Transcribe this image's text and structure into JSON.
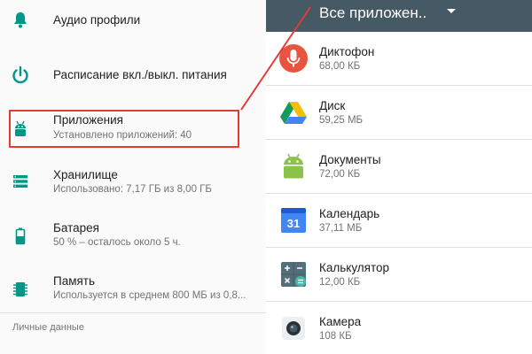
{
  "settings": {
    "items": [
      {
        "title": "Аудио профили",
        "subtitle": "",
        "icon": "bell-icon"
      },
      {
        "title": "Расписание вкл./выкл. питания",
        "subtitle": "",
        "icon": "power-icon"
      },
      {
        "title": "Приложения",
        "subtitle": "Установлено приложений: 40",
        "icon": "android-icon"
      },
      {
        "title": "Хранилище",
        "subtitle": "Использовано: 7,17 ГБ из 8,00 ГБ",
        "icon": "storage-icon"
      },
      {
        "title": "Батарея",
        "subtitle": "50 % – осталось около 5 ч.",
        "icon": "battery-icon"
      },
      {
        "title": "Память",
        "subtitle": "Используется в среднем 800 МБ из 0,8...",
        "icon": "memory-icon"
      }
    ],
    "section_label": "Личные данные",
    "accent_color": "#009688",
    "highlight_color": "#e53935"
  },
  "apps": {
    "filter_label": "Все приложен..",
    "items": [
      {
        "name": "Диктофон",
        "size": "68,00 КБ",
        "icon": "recorder-icon"
      },
      {
        "name": "Диск",
        "size": "59,25 МБ",
        "icon": "drive-icon"
      },
      {
        "name": "Документы",
        "size": "72,00 КБ",
        "icon": "docs-android-icon"
      },
      {
        "name": "Календарь",
        "size": "37,11 МБ",
        "icon": "calendar-icon",
        "icon_text": "31"
      },
      {
        "name": "Калькулятор",
        "size": "12,00 КБ",
        "icon": "calculator-icon"
      },
      {
        "name": "Камера",
        "size": "108 КБ",
        "icon": "camera-icon"
      }
    ]
  }
}
